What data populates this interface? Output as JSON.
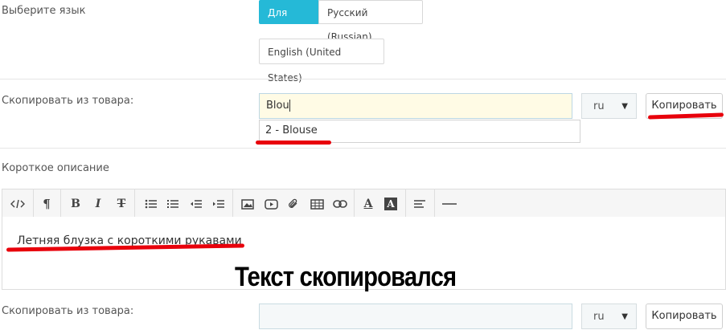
{
  "language_row": {
    "label": "Выберите язык",
    "buttons": [
      {
        "label": "Для всех",
        "active": true
      },
      {
        "label": "Русский (Russian)",
        "active": false
      },
      {
        "label": "English (United States)",
        "active": false
      }
    ]
  },
  "copy_row_1": {
    "label": "Скопировать из товара:",
    "input_value": "Blou",
    "lang_select": "ru",
    "copy_button": "Копировать",
    "suggestion": "2 - Blouse"
  },
  "short_description": {
    "label": "Короткое описание",
    "toolbar_icons": [
      "code-view-icon",
      "paragraph-icon",
      "bold-icon",
      "italic-icon",
      "strikethrough-icon",
      "unordered-list-icon",
      "ordered-list-icon",
      "outdent-icon",
      "indent-icon",
      "image-icon",
      "video-icon",
      "attachment-icon",
      "table-icon",
      "link-icon",
      "font-color-icon",
      "background-color-icon",
      "align-icon",
      "horizontal-rule-icon"
    ],
    "content": "Летняя блузка с короткими рукавами"
  },
  "overlay_caption": "Текст скопировался",
  "copy_row_2": {
    "label": "Скопировать из товара:",
    "input_value": "",
    "lang_select": "ru",
    "copy_button": "Копировать"
  },
  "colors": {
    "accent": "#25b9d7",
    "annotation_red": "#e8000b",
    "focused_input_bg": "#fffbe5"
  }
}
